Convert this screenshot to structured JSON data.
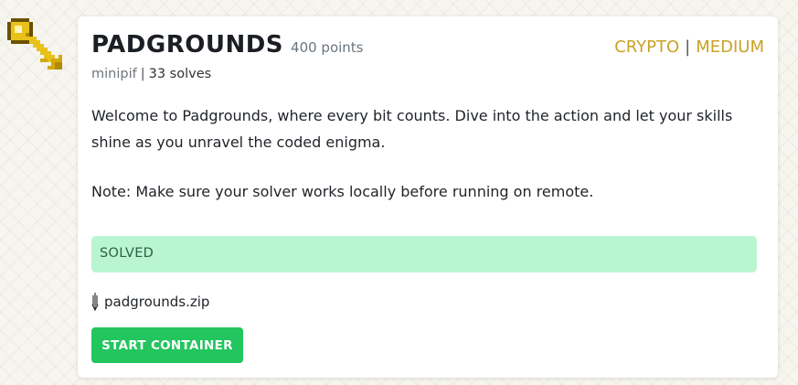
{
  "challenge": {
    "title": "PADGROUNDS",
    "points": "400 points",
    "author": "minipif",
    "meta_separator": "|",
    "solves": "33 solves",
    "category": "CRYPTO",
    "tag_separator": "|",
    "difficulty": "MEDIUM",
    "description_1": "Welcome to Padgrounds, where every bit counts. Dive into the action and let your skills shine as you unravel the coded enigma.",
    "description_2": "Note: Make sure your solver works locally before running on remote.",
    "status": "SOLVED",
    "attachment": "padgrounds.zip",
    "start_button": "START CONTAINER"
  },
  "colors": {
    "accent_gold": "#c9a227",
    "solved_bg": "#baf5d1",
    "button_green": "#22c55e"
  },
  "icons": {
    "category": "key-icon",
    "attachment": "download-icon"
  }
}
